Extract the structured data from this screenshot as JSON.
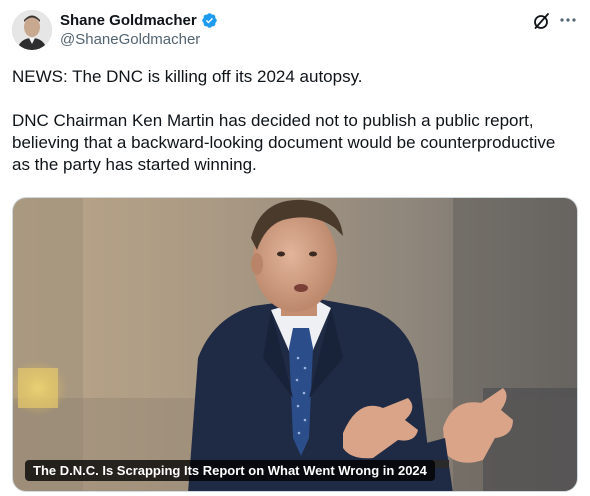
{
  "author": {
    "display_name": "Shane Goldmacher",
    "handle": "@ShaneGoldmacher",
    "verified": true,
    "verified_color": "#1d9bf0"
  },
  "actions": {
    "grok_icon": "grok-slash-circle-icon",
    "more_icon": "more-horizontal-icon"
  },
  "tweet": {
    "paragraphs": [
      "NEWS: The DNC is killing off its 2024 autopsy.",
      "DNC Chairman Ken Martin has decided not to publish a public report, believing that a backward-looking document would be counterproductive as the party has started winning."
    ]
  },
  "media": {
    "caption": "The D.N.C. Is Scrapping Its Report on What Went Wrong in 2024"
  }
}
